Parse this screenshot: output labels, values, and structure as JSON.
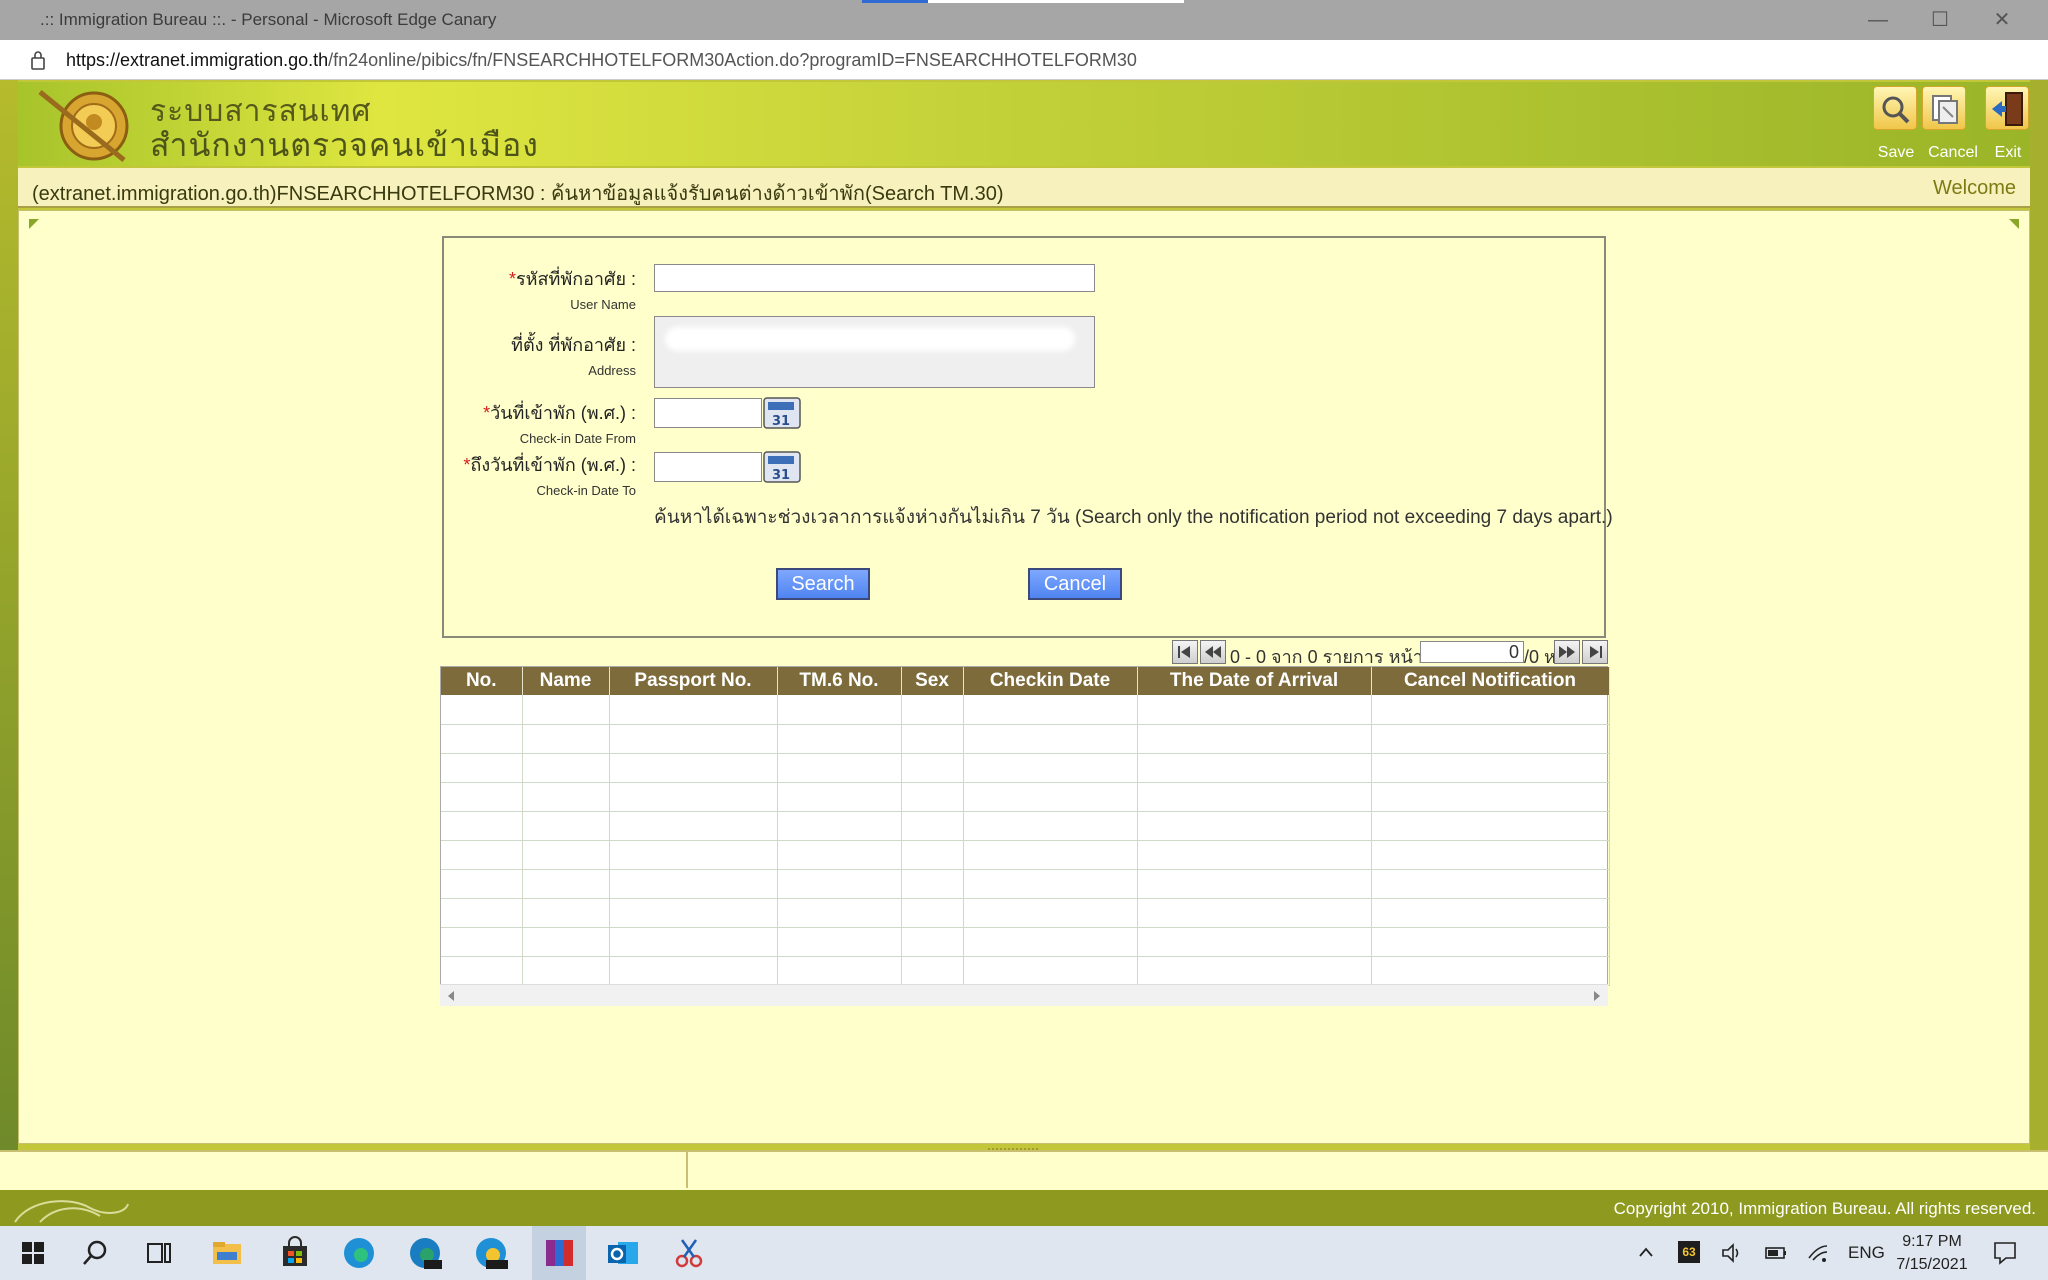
{
  "window": {
    "title": ".:: Immigration Bureau ::. - Personal - Microsoft Edge Canary",
    "url_host": "https://extranet.immigration.go.th",
    "url_path": "/fn24online/pibics/fn/FNSEARCHHOTELFORM30Action.do?programID=FNSEARCHHOTELFORM30",
    "minimize": "—",
    "maximize": "☐",
    "close": "✕"
  },
  "header": {
    "brand_line1": "ระบบสารสนเทศ",
    "brand_line2": "สำนักงานตรวจคนเข้าเมือง",
    "tools": [
      {
        "label": "Save",
        "icon": "search-icon"
      },
      {
        "label": "Cancel",
        "icon": "cancel-document-icon"
      },
      {
        "label": "Exit",
        "icon": "exit-door-icon"
      }
    ],
    "page_title": "(extranet.immigration.go.th)FNSEARCHHOTELFORM30 : ค้นหาข้อมูลแจ้งรับคนต่างด้าวเข้าพัก(Search TM.30)",
    "welcome": "Welcome"
  },
  "form": {
    "user_name": {
      "required": "*",
      "label_th": "รหัสที่พักอาศัย :",
      "label_en": "User Name",
      "value": ""
    },
    "address": {
      "label_th": "ที่ตั้ง ที่พักอาศัย :",
      "label_en": "Address",
      "value": ""
    },
    "checkin_from": {
      "required": "*",
      "label_th": "วันที่เข้าพัก (พ.ศ.) :",
      "label_en": "Check-in Date From",
      "value": "",
      "calendar": "31"
    },
    "checkin_to": {
      "required": "*",
      "label_th": "ถึงวันที่เข้าพัก (พ.ศ.) :",
      "label_en": "Check-in Date To",
      "value": "",
      "calendar": "31"
    },
    "note": "ค้นหาได้เฉพาะช่วงเวลาการแจ้งห่างกันไม่เกิน 7 วัน (Search only the notification period not exceeding 7 days apart.)",
    "search_label": "Search",
    "cancel_label": "Cancel"
  },
  "pager": {
    "summary": "0 - 0 จาก 0 รายการ หน้า",
    "page_value": "0",
    "page_total": "/0 หน้า"
  },
  "table": {
    "columns": [
      "No.",
      "Name",
      "Passport No.",
      "TM.6 No.",
      "Sex",
      "Checkin Date",
      "The Date of Arrival",
      "Cancel Notification"
    ],
    "empty_rows": 10
  },
  "footer": {
    "copyright": "Copyright 2010, Immigration Bureau. All rights reserved."
  },
  "taskbar": {
    "apps": [
      "start-icon",
      "search-icon",
      "task-view-icon",
      "file-explorer-icon",
      "store-icon",
      "edge-icon",
      "edge-dev-icon",
      "edge-canary-icon",
      "winrar-icon",
      "outlook-icon",
      "snipping-tool-icon"
    ],
    "tray_badge": "63",
    "language": "ENG",
    "time": "9:17 PM",
    "date": "7/15/2021"
  }
}
